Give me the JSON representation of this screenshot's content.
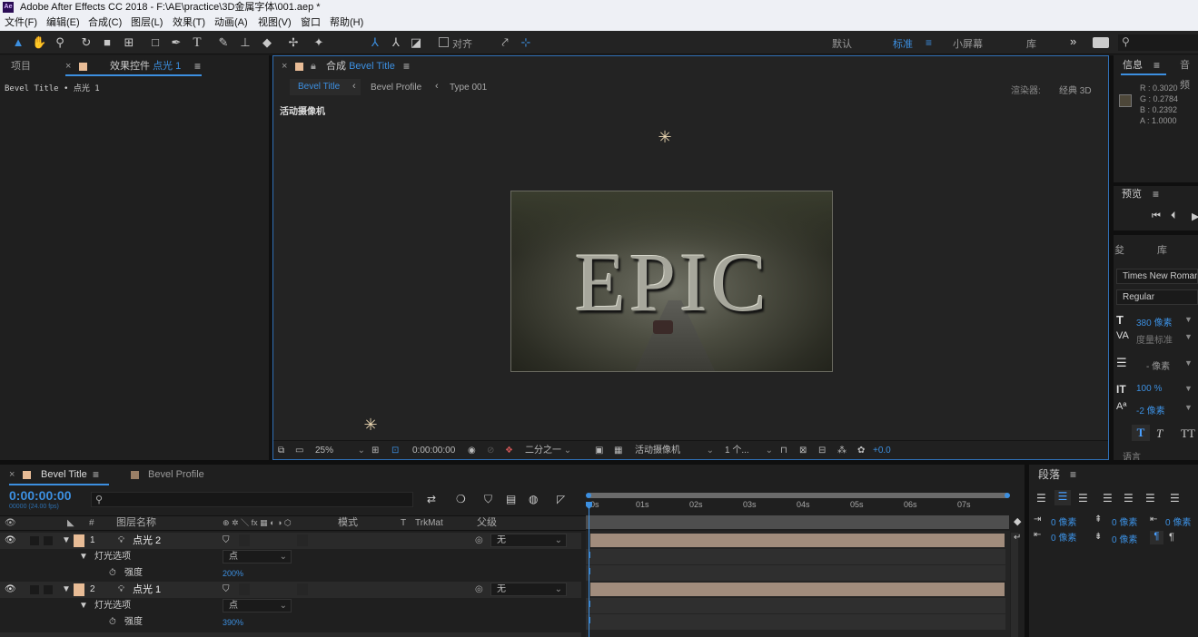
{
  "window": {
    "title": "Adobe After Effects CC 2018 - F:\\AE\\practice\\3D金属字体\\001.aep *",
    "logo": "Ae"
  },
  "menu": [
    "文件(F)",
    "编辑(E)",
    "合成(C)",
    "图层(L)",
    "效果(T)",
    "动画(A)",
    "视图(V)",
    "窗口",
    "帮助(H)"
  ],
  "toolbar": {
    "snap_label": "对齐",
    "workspaces": [
      "默认",
      "标准",
      "小屏幕",
      "库"
    ],
    "active_workspace": "标准",
    "more": "»",
    "icons": [
      "selection-tool-icon",
      "hand-tool-icon",
      "zoom-tool-icon",
      "rotate-tool-icon",
      "camera-tool-icon",
      "pan-behind-tool-icon",
      "rectangle-tool-icon",
      "pen-tool-icon",
      "type-tool-icon",
      "brush-tool-icon",
      "clone-stamp-tool-icon",
      "eraser-tool-icon",
      "roto-brush-tool-icon",
      "puppet-tool-icon"
    ]
  },
  "project_panel": {
    "tab_project": "项目",
    "tab_effects_prefix": "效果控件",
    "tab_effects_layer": "点光 1",
    "breadcrumb": "Bevel Title • 点光 1"
  },
  "comp_panel": {
    "tab_prefix": "合成",
    "tab_name": "Bevel Title",
    "nav": [
      "Bevel Title",
      "Bevel Profile",
      "Type 001"
    ],
    "renderer_label": "渲染器:",
    "renderer_value": "经典 3D",
    "camera_label": "活动摄像机",
    "title_text": "EPIC",
    "footer": {
      "zoom": "25%",
      "timecode": "0:00:00:00",
      "resolution": "二分之一",
      "camera": "活动摄像机",
      "views": "1 个...",
      "exposure": "+0.0"
    }
  },
  "info_panel": {
    "tab_info": "信息",
    "tab_audio": "音频",
    "r": "R : 0.3020",
    "g": "G : 0.2784",
    "b": "B : 0.2392",
    "a": "A : 1.0000",
    "color": "#4d4739"
  },
  "preview_panel": {
    "title": "预览"
  },
  "char_panel": {
    "tab1": "夋",
    "tab2": "库",
    "font": "Times New Roman",
    "style": "Regular",
    "size": "380 像素",
    "kerning": "度量标准",
    "leading": "- 像素",
    "vscale": "100 %",
    "baseline": "-2 像素",
    "bottom_cut": "语言"
  },
  "paragraph_panel": {
    "title": "段落",
    "indent_left": "0 像素",
    "indent_first": "0 像素",
    "indent_right": "0 像素",
    "space_before": "0 像素",
    "space_after": "0 像素"
  },
  "timeline": {
    "tab_active": "Bevel Title",
    "tab_other": "Bevel Profile",
    "timecode": "0:00:00:00",
    "timecode_sub": "00000 (24.00 fps)",
    "search_placeholder": "",
    "col_num": "#",
    "col_name": "图层名称",
    "col_mode": "模式",
    "col_t": "T",
    "col_trkmat": "TrkMat",
    "col_parent": "父级",
    "ruler": [
      "0s",
      "01s",
      "02s",
      "03s",
      "04s",
      "05s",
      "06s",
      "07s"
    ],
    "layers": [
      {
        "num": "1",
        "name": "点光 2",
        "parent": "无",
        "options": "灯光选项",
        "type": "点",
        "prop": "强度",
        "value": "200%"
      },
      {
        "num": "2",
        "name": "点光 1",
        "parent": "无",
        "options": "灯光选项",
        "type": "点",
        "prop": "强度",
        "value": "390%"
      }
    ]
  },
  "colors": {
    "accent": "#3c8fe0",
    "label": "#e8bc96",
    "bar": "#a18c7c"
  }
}
